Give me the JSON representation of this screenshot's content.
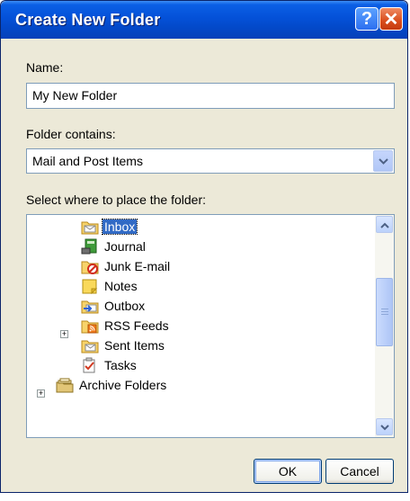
{
  "dialog": {
    "title": "Create New Folder",
    "help_glyph": "?",
    "close_glyph": "✕"
  },
  "form": {
    "name_label": "Name:",
    "name_value": "My New Folder",
    "contains_label": "Folder contains:",
    "contains_value": "Mail and Post Items",
    "place_label": "Select where to place the folder:"
  },
  "tree": {
    "items": [
      {
        "label": "Inbox",
        "icon": "inbox-folder-icon",
        "selected": true
      },
      {
        "label": "Journal",
        "icon": "journal-icon"
      },
      {
        "label": "Junk E-mail",
        "icon": "junk-folder-icon"
      },
      {
        "label": "Notes",
        "icon": "notes-icon"
      },
      {
        "label": "Outbox",
        "icon": "outbox-folder-icon"
      },
      {
        "label": "RSS Feeds",
        "icon": "rss-folder-icon",
        "expandable": true
      },
      {
        "label": "Sent Items",
        "icon": "sent-folder-icon"
      },
      {
        "label": "Tasks",
        "icon": "tasks-icon"
      },
      {
        "label": "Archive Folders",
        "icon": "archive-folders-icon",
        "expandable": true
      }
    ]
  },
  "buttons": {
    "ok": "OK",
    "cancel": "Cancel"
  },
  "colors": {
    "titlebar": "#0451d8",
    "dialog_bg": "#ece9d8",
    "selection": "#316ac5"
  }
}
